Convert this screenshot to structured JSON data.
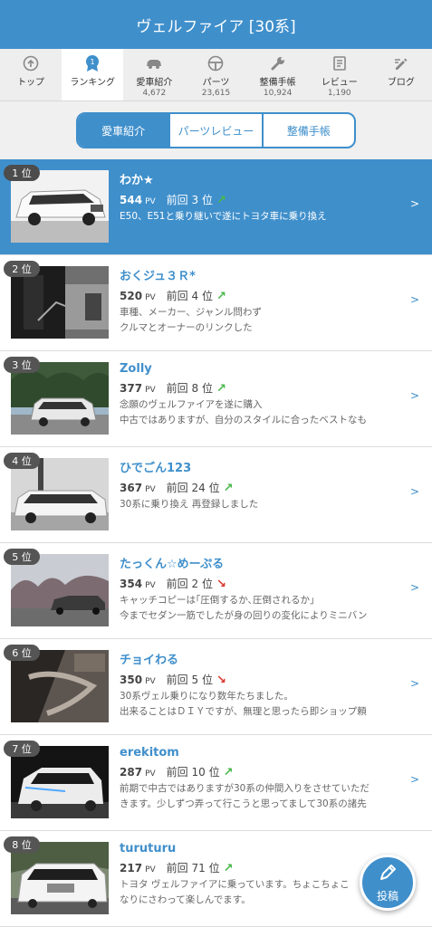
{
  "header": {
    "title": "ヴェルファイア [30系]"
  },
  "tabs": [
    {
      "label": "トップ",
      "count": "",
      "icon": "top-icon"
    },
    {
      "label": "ランキング",
      "count": "",
      "icon": "ranking-icon",
      "badge": "1"
    },
    {
      "label": "愛車紹介",
      "count": "4,672",
      "icon": "car-icon"
    },
    {
      "label": "パーツ",
      "count": "23,615",
      "icon": "steering-wheel-icon"
    },
    {
      "label": "整備手帳",
      "count": "10,924",
      "icon": "wrench-icon"
    },
    {
      "label": "レビュー",
      "count": "1,190",
      "icon": "review-icon"
    },
    {
      "label": "ブログ",
      "count": "",
      "icon": "blog-icon"
    }
  ],
  "segments": {
    "s0": "愛車紹介",
    "s1": "パーツレビュー",
    "s2": "整備手帳"
  },
  "pv_unit": "PV",
  "prev_label": "前回",
  "fab": {
    "label": "投稿"
  },
  "rows": [
    {
      "rank": "1 位",
      "name": "わか★",
      "pv": "544",
      "prev": "3 位",
      "trend": "up",
      "d1": "E50、E51と乗り継いで遂にトヨタ車に乗り換え",
      "d2": ""
    },
    {
      "rank": "2 位",
      "name": "おくジュ３Ｒ*",
      "pv": "520",
      "prev": "4 位",
      "trend": "up",
      "d1": "車種、メーカー、ジャンル問わず",
      "d2": "クルマとオーナーのリンクした"
    },
    {
      "rank": "3 位",
      "name": "Zolly",
      "pv": "377",
      "prev": "8 位",
      "trend": "up",
      "d1": "念願のヴェルファイアを遂に購入",
      "d2": "中古ではありますが、自分のスタイルに合ったベストなも"
    },
    {
      "rank": "4 位",
      "name": "ひでごん123",
      "pv": "367",
      "prev": "24 位",
      "trend": "up",
      "d1": "30系に乗り換え 再登録しました",
      "d2": ""
    },
    {
      "rank": "5 位",
      "name": "たっくん☆めーぷる",
      "pv": "354",
      "prev": "2 位",
      "trend": "down",
      "d1": "キャッチコピーは｢圧倒するか､圧倒されるか｣",
      "d2": "今までセダン一筋でしたが身の回りの変化によりミニバン"
    },
    {
      "rank": "6 位",
      "name": "チョイわる",
      "pv": "350",
      "prev": "5 位",
      "trend": "down",
      "d1": "30系ヴェル乗りになり数年たちました。",
      "d2": "出来ることはＤＩＹですが、無理と思ったら即ショップ頼"
    },
    {
      "rank": "7 位",
      "name": "erekitom",
      "pv": "287",
      "prev": "10 位",
      "trend": "up",
      "d1": "前期で中古ではありますが30系の仲間入りをさせていただ",
      "d2": "きます。少しずつ弄って行こうと思ってまして30系の諸先"
    },
    {
      "rank": "8 位",
      "name": "turuturu",
      "pv": "217",
      "prev": "71 位",
      "trend": "up",
      "d1": "トヨタ ヴェルファイアに乗っています。ちょこちょこ",
      "d2": "なりにさわって楽しんでます。"
    }
  ]
}
